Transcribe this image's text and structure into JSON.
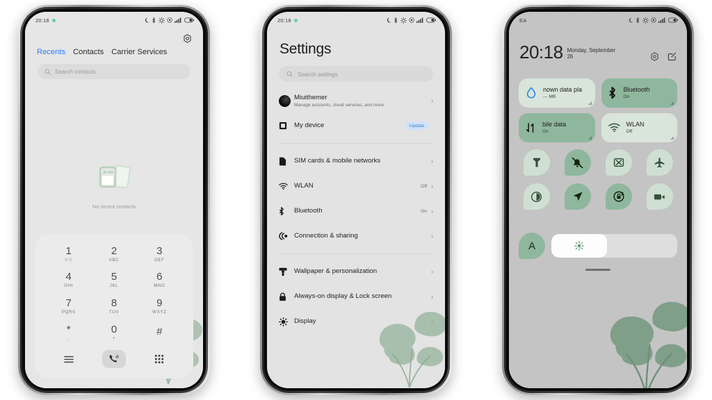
{
  "status_bar": {
    "time": "20:18",
    "icons": [
      "dnd-moon-icon",
      "bluetooth-icon",
      "vpn-icon",
      "location-icon",
      "signal-bars-icon",
      "battery-icon"
    ]
  },
  "phone1_dialer": {
    "gear_icon": "settings-gear-icon",
    "tabs": [
      {
        "label": "Recents",
        "active": true
      },
      {
        "label": "Contacts",
        "active": false
      },
      {
        "label": "Carrier Services",
        "active": false
      }
    ],
    "search": {
      "placeholder": "Search contacts",
      "icon": "search-icon"
    },
    "empty_state": {
      "label": "No recent contacts",
      "icon": "empty-contacts-cards-icon"
    },
    "keypad": [
      {
        "num": "1",
        "sub": "☉☉"
      },
      {
        "num": "2",
        "sub": "ABC"
      },
      {
        "num": "3",
        "sub": "DEF"
      },
      {
        "num": "4",
        "sub": "GHI"
      },
      {
        "num": "5",
        "sub": "JKL"
      },
      {
        "num": "6",
        "sub": "MNO"
      },
      {
        "num": "7",
        "sub": "PQRS"
      },
      {
        "num": "8",
        "sub": "TUV"
      },
      {
        "num": "9",
        "sub": "WXYZ"
      },
      {
        "num": "*",
        "sub": ","
      },
      {
        "num": "0",
        "sub": "+"
      },
      {
        "num": "#",
        "sub": ""
      }
    ],
    "bottom_bar": {
      "menu_icon": "hamburger-menu-icon",
      "call_icon": "call-phone-icon",
      "keypad_icon": "dialpad-icon"
    }
  },
  "phone2_settings": {
    "title": "Settings",
    "search": {
      "placeholder": "Search settings",
      "icon": "search-icon"
    },
    "groups": [
      {
        "rows": [
          {
            "label": "Miuithemer",
            "sub": "Manage accounts, cloud services, and more",
            "icon": "account-avatar-icon",
            "value": "",
            "badge": "",
            "chevron": true
          },
          {
            "label": "My device",
            "sub": "",
            "icon": "device-icon",
            "value": "",
            "badge": "Update",
            "chevron": false
          }
        ]
      },
      {
        "rows": [
          {
            "label": "SIM cards & mobile networks",
            "sub": "",
            "icon": "sim-card-icon",
            "value": "",
            "badge": "",
            "chevron": true
          },
          {
            "label": "WLAN",
            "sub": "",
            "icon": "wifi-icon",
            "value": "Off",
            "badge": "",
            "chevron": true
          },
          {
            "label": "Bluetooth",
            "sub": "",
            "icon": "bluetooth-icon",
            "value": "On",
            "badge": "",
            "chevron": true
          },
          {
            "label": "Connection & sharing",
            "sub": "",
            "icon": "connection-sharing-icon",
            "value": "",
            "badge": "",
            "chevron": true
          }
        ]
      },
      {
        "rows": [
          {
            "label": "Wallpaper & personalization",
            "sub": "",
            "icon": "wallpaper-brush-icon",
            "value": "",
            "badge": "",
            "chevron": true
          },
          {
            "label": "Always-on display & Lock screen",
            "sub": "",
            "icon": "lock-icon",
            "value": "",
            "badge": "",
            "chevron": true
          },
          {
            "label": "Display",
            "sub": "",
            "icon": "brightness-sun-icon",
            "value": "",
            "badge": "",
            "chevron": true
          }
        ]
      }
    ]
  },
  "phone3_control_center": {
    "carrier": "EA",
    "time": "20:18",
    "date": "Monday, September 26",
    "header_icons": [
      "settings-gear-icon",
      "edit-pencil-icon"
    ],
    "tiles": [
      {
        "title": "nown data pla",
        "sub": "--- MB",
        "state": "off",
        "icon": "data-usage-drop-icon"
      },
      {
        "title": "Bluetooth",
        "sub": "On",
        "state": "on",
        "icon": "bluetooth-icon"
      },
      {
        "title": "bile data",
        "sub": "On",
        "state": "on",
        "icon": "mobile-data-arrows-icon"
      },
      {
        "title": "WLAN",
        "sub": "Off",
        "state": "off",
        "icon": "wifi-icon"
      }
    ],
    "quick_toggles": [
      {
        "icon": "flashlight-icon",
        "state": "off"
      },
      {
        "icon": "silent-bell-icon",
        "state": "on"
      },
      {
        "icon": "screenshot-icon",
        "state": "off"
      },
      {
        "icon": "airplane-mode-icon",
        "state": "off"
      },
      {
        "icon": "dark-mode-contrast-icon",
        "state": "off"
      },
      {
        "icon": "location-arrow-icon",
        "state": "on"
      },
      {
        "icon": "auto-rotate-lock-icon",
        "state": "on"
      },
      {
        "icon": "screen-record-icon",
        "state": "off"
      }
    ],
    "brightness": {
      "auto_label": "A",
      "icon": "brightness-sun-icon",
      "level": 44
    }
  },
  "colors": {
    "accent_blue": "#2d7df6",
    "tile_on": "#8fb79e",
    "tile_off": "#d9e5da",
    "leaf_green": "#8aa993",
    "cc_background": "#c4c4c4",
    "settings_background": "#e3e3e3"
  }
}
